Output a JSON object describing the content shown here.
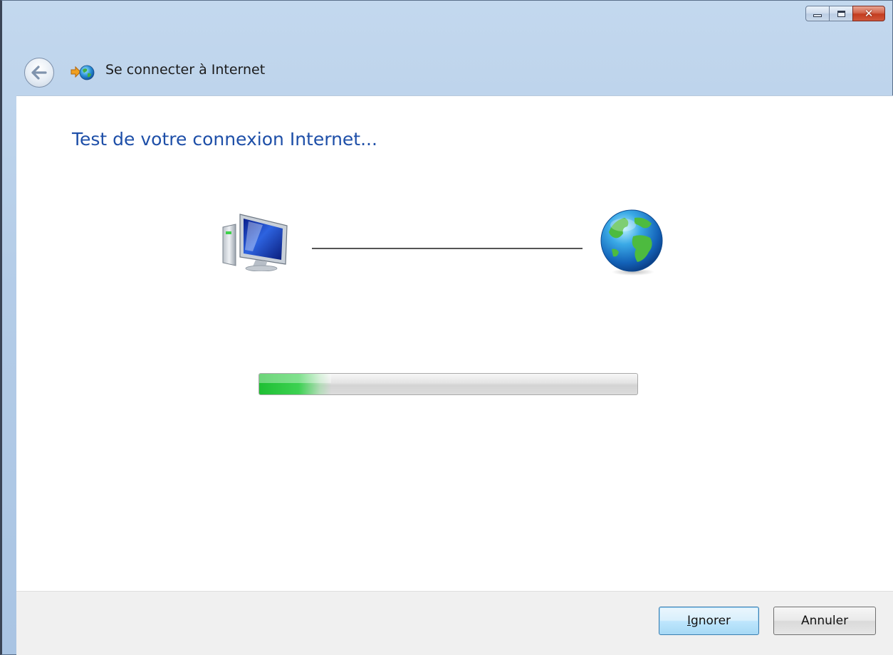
{
  "window": {
    "title": "Se connecter à Internet",
    "controls": {
      "minimize_icon": "minimize-icon",
      "maximize_icon": "maximize-icon",
      "close_icon": "close-icon"
    }
  },
  "navigation": {
    "back_icon": "back-arrow-icon"
  },
  "main": {
    "heading": "Test de votre connexion Internet...",
    "computer_icon": "computer-icon",
    "globe_icon": "globe-icon",
    "progress": {
      "value": 0.19,
      "color": "#2bc23f"
    }
  },
  "footer": {
    "skip_button": {
      "accel": "I",
      "rest": "gnorer"
    },
    "cancel_button": "Annuler"
  },
  "colors": {
    "heading": "#1e4fa8",
    "caption_bar": "#b9d1ea",
    "close_button": "#c94a2e",
    "default_button_border": "#3c7fb1"
  }
}
